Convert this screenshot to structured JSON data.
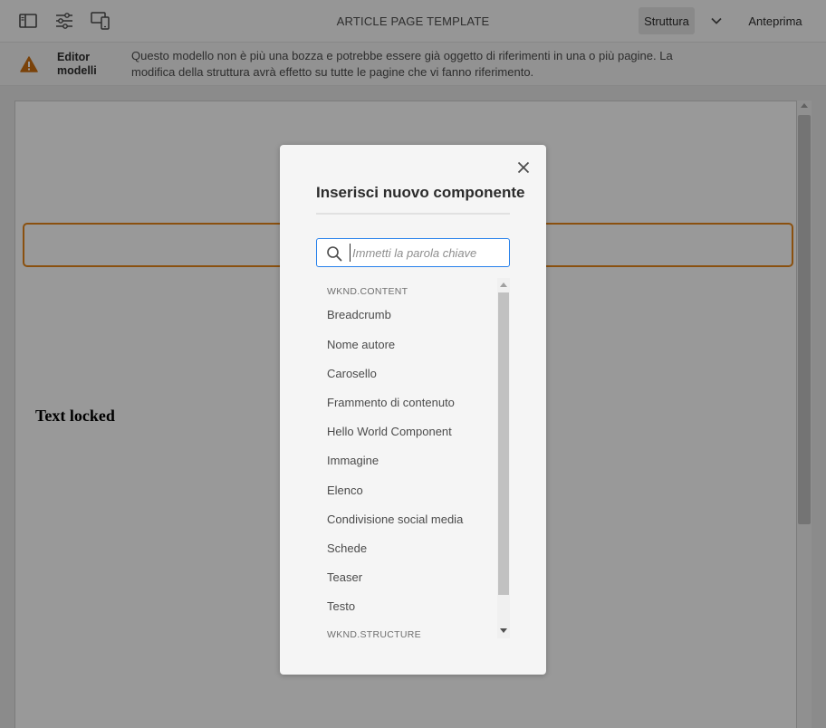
{
  "topbar": {
    "icons": [
      "side-panel-icon",
      "page-properties-icon",
      "device-emulator-icon"
    ],
    "title": "ARTICLE PAGE TEMPLATE",
    "struttura_label": "Struttura",
    "anteprima_label": "Anteprima"
  },
  "alert": {
    "icon": "alert-icon",
    "title": "Editor modelli",
    "text": "Questo modello non è più una bozza e potrebbe essere già oggetto di riferimenti in una o più pagine. La modifica della struttura avrà effetto su tutte le pagine che vi fanno riferimento."
  },
  "page": {
    "text_locked": "Text locked"
  },
  "modal": {
    "title": "Inserisci nuovo componente",
    "search_placeholder": "Immetti la parola chiave",
    "groups": [
      {
        "label": "WKND.CONTENT",
        "items": [
          "Breadcrumb",
          "Nome autore",
          "Carosello",
          "Frammento di contenuto",
          "Hello World Component",
          "Immagine",
          "Elenco",
          "Condivisione social media",
          "Schede",
          "Teaser",
          "Testo"
        ]
      },
      {
        "label": "WKND.STRUCTURE",
        "items": []
      }
    ]
  },
  "colors": {
    "accent": "#2680eb",
    "warning": "#e68619",
    "alert_icon": "#cb6f10"
  }
}
